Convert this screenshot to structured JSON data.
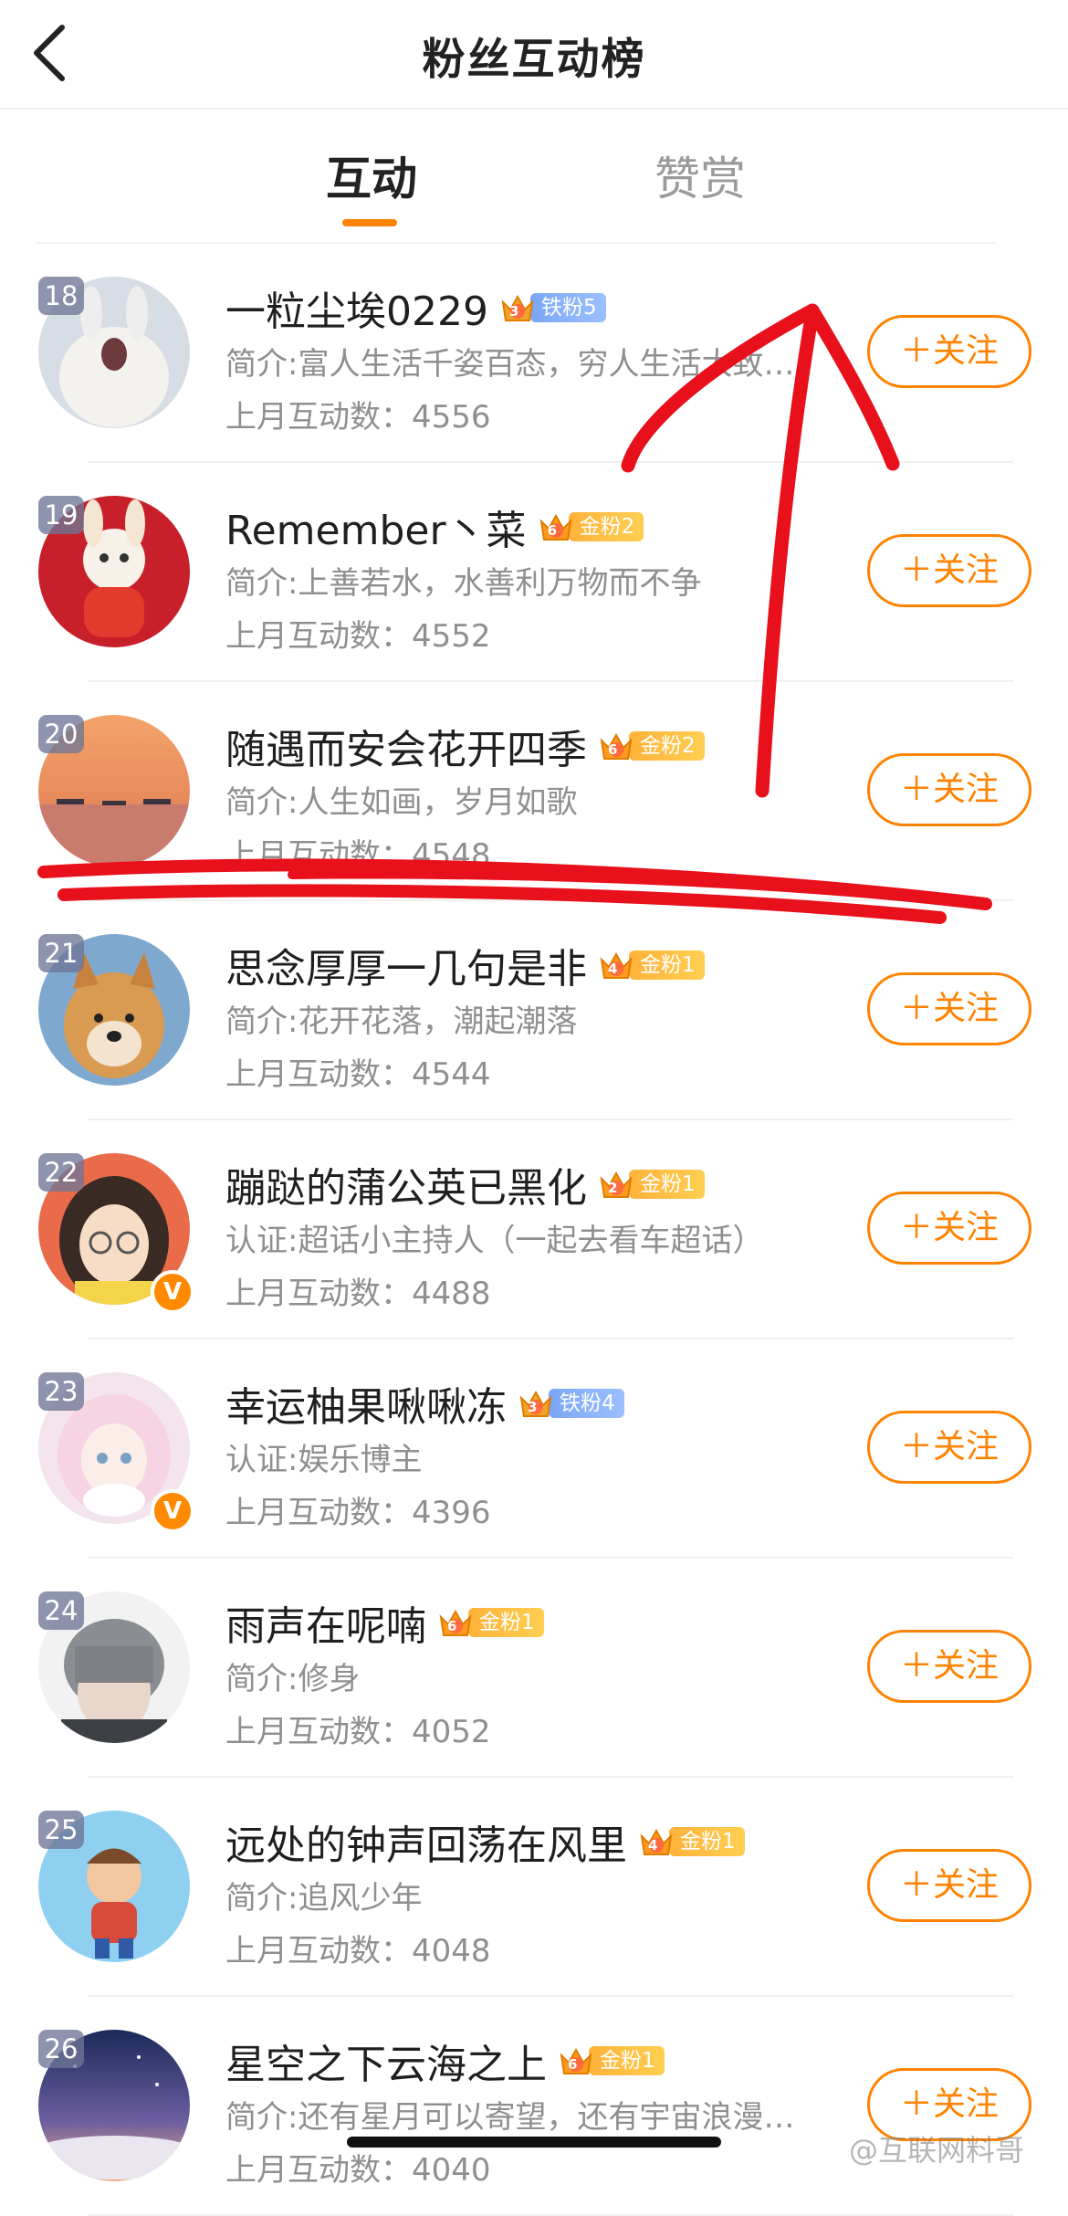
{
  "header": {
    "title": "粉丝互动榜"
  },
  "tabs": [
    {
      "label": "互动",
      "active": true
    },
    {
      "label": "赞赏",
      "active": false
    }
  ],
  "follow_label": "＋关注",
  "count_prefix": "上月互动数：",
  "rows": [
    {
      "rank": "18",
      "name": "一粒尘埃0229",
      "level": "3",
      "badge": "铁粉5",
      "badge_type": "iron",
      "bio": "简介:富人生活千姿百态，穷人生活大致…",
      "count": "4556",
      "verified": false
    },
    {
      "rank": "19",
      "name": "Remember丶菜",
      "level": "6",
      "badge": "金粉2",
      "badge_type": "gold",
      "bio": "简介:上善若水，水善利万物而不争",
      "count": "4552",
      "verified": false
    },
    {
      "rank": "20",
      "name": "随遇而安会花开四季",
      "level": "6",
      "badge": "金粉2",
      "badge_type": "gold",
      "bio": "简介:人生如画，岁月如歌",
      "count": "4548",
      "verified": false
    },
    {
      "rank": "21",
      "name": "思念厚厚一几句是非",
      "level": "4",
      "badge": "金粉1",
      "badge_type": "gold",
      "bio": "简介:花开花落，潮起潮落",
      "count": "4544",
      "verified": false
    },
    {
      "rank": "22",
      "name": "蹦跶的蒲公英已黑化",
      "level": "2",
      "badge": "金粉1",
      "badge_type": "gold",
      "bio": "认证:超话小主持人（一起去看车超话）",
      "count": "4488",
      "verified": true
    },
    {
      "rank": "23",
      "name": "幸运柚果啾啾冻",
      "level": "3",
      "badge": "铁粉4",
      "badge_type": "iron",
      "bio": "认证:娱乐博主",
      "count": "4396",
      "verified": true
    },
    {
      "rank": "24",
      "name": "雨声在呢喃",
      "level": "6",
      "badge": "金粉1",
      "badge_type": "gold",
      "bio": "简介:修身",
      "count": "4052",
      "verified": false
    },
    {
      "rank": "25",
      "name": "远处的钟声回荡在风里",
      "level": "4",
      "badge": "金粉1",
      "badge_type": "gold",
      "bio": "简介:追风少年",
      "count": "4048",
      "verified": false
    },
    {
      "rank": "26",
      "name": "星空之下云海之上",
      "level": "6",
      "badge": "金粉1",
      "badge_type": "gold",
      "bio": "简介:还有星月可以寄望，还有宇宙浪漫…",
      "count": "4040",
      "verified": false
    }
  ],
  "verified_mark": "V",
  "watermark": "@互联网料哥",
  "colors": {
    "accent": "#ff8200",
    "annotation": "#e8101a",
    "gold_badge": "#ffb23a",
    "iron_badge": "#7aa6f5"
  }
}
